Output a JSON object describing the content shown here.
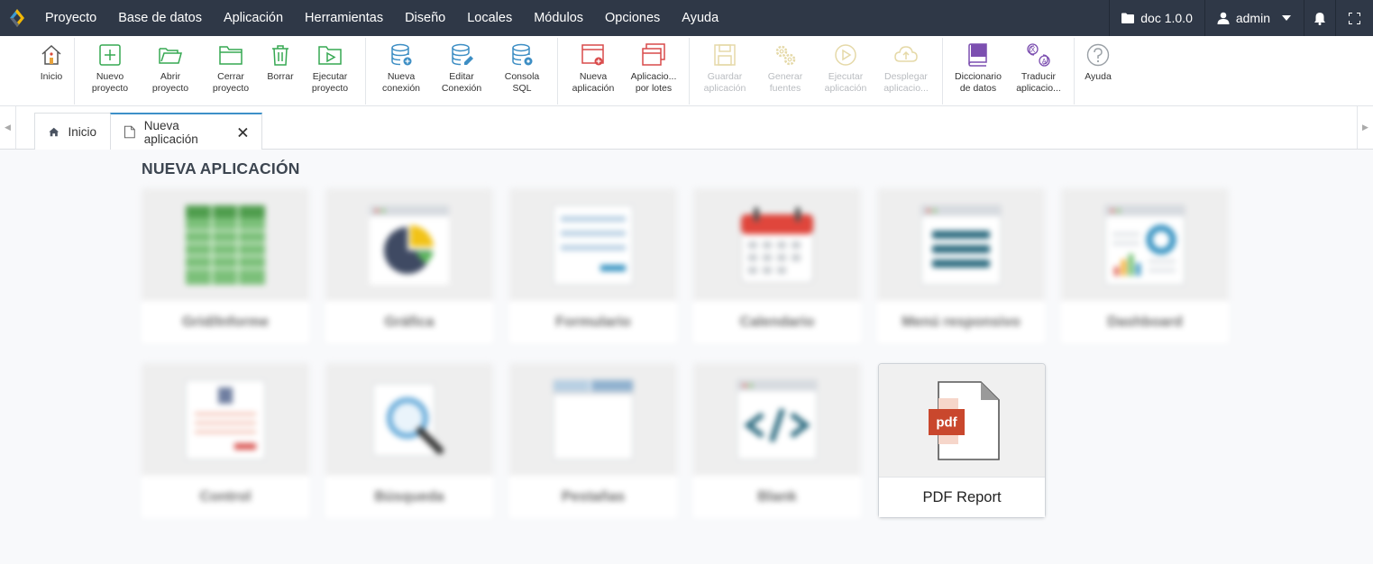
{
  "menubar": {
    "items": [
      "Proyecto",
      "Base de datos",
      "Aplicación",
      "Herramientas",
      "Diseño",
      "Locales",
      "Módulos",
      "Opciones",
      "Ayuda"
    ],
    "project": "doc 1.0.0",
    "user": "admin"
  },
  "toolbar": {
    "inicio": "Inicio",
    "nuevo_proyecto": "Nuevo\nproyecto",
    "abrir_proyecto": "Abrir\nproyecto",
    "cerrar_proyecto": "Cerrar\nproyecto",
    "borrar": "Borrar",
    "ejecutar_proyecto": "Ejecutar\nproyecto",
    "nueva_conexion": "Nueva\nconexión",
    "editar_conexion": "Editar\nConexión",
    "consola_sql": "Consola\nSQL",
    "nueva_aplicacion": "Nueva\naplicación",
    "aplicacion_lotes": "Aplicacio...\npor lotes",
    "guardar_aplicacion": "Guardar\naplicación",
    "generar_fuentes": "Generar\nfuentes",
    "ejecutar_aplicacion": "Ejecutar\naplicación",
    "desplegar_aplicacion": "Desplegar\naplicacio...",
    "diccionario_datos": "Diccionario\nde datos",
    "traducir_aplicacion": "Traducir\naplicacio...",
    "ayuda": "Ayuda"
  },
  "tabs": [
    {
      "label": "Inicio"
    },
    {
      "label": "Nueva aplicación"
    }
  ],
  "page": {
    "title": "NUEVA APLICACIÓN",
    "cards": [
      "Grid/Informe",
      "Gráfica",
      "Formulario",
      "Calendario",
      "Menú responsivo",
      "Dashboard",
      "Control",
      "Búsqueda",
      "Pestañas",
      "Blank",
      "PDF Report"
    ],
    "pdf_icon_text": "pdf"
  },
  "colors": {
    "menubar": "#2f3847",
    "accent": "#3d90c8",
    "pdf_red": "#c9472d"
  }
}
